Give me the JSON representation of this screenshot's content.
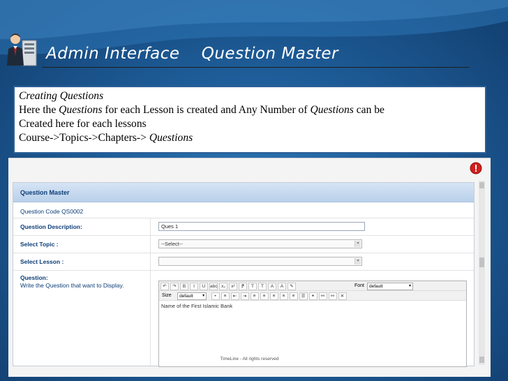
{
  "slide": {
    "title": "Admin Interface    Question Master",
    "description": {
      "line1": "Creating Questions",
      "line2_a": "Here the ",
      "line2_em1": "Questions",
      "line2_b": " for each Lesson is created and Any Number of ",
      "line2_em2": "Questions",
      "line2_c": " can be",
      "line3": "Created here for each lessons",
      "line4_a": "Course->Topics->Chapters-> ",
      "line4_em": "Questions"
    }
  },
  "app": {
    "panel_title": "Question Master",
    "question_code": "Question Code QS0002",
    "fields": {
      "description_label": "Question Description:",
      "description_value": "Ques 1",
      "topic_label": "Select Topic :",
      "topic_value": "--Select--",
      "lesson_label": "Select Lesson :",
      "lesson_value": "",
      "question_label": "Question:",
      "question_hint": "Write the Question that want to Display."
    },
    "editor": {
      "font_label": "Font",
      "font_value": "default",
      "size_label": "Size",
      "size_value": "default",
      "content": "Name of the First Islamic Bank",
      "toolbar_row1": [
        "↶",
        "↷",
        "B",
        "I",
        "U",
        "abc",
        "x₂",
        "x²",
        "⁋",
        "T",
        "T",
        "A",
        "A",
        "✎"
      ],
      "toolbar_row2": [
        "•",
        "≡",
        "⇤",
        "⇥",
        "≡",
        "≡",
        "≡",
        "≡",
        "≡",
        "☰",
        "⚭",
        "⚯",
        "⚯",
        "✕"
      ]
    },
    "footer": "TimeLine - All rights reserved",
    "colors": {
      "slide_bg": "#1e5d99",
      "panel_header": "#c7daf0",
      "label_text": "#0d3e78",
      "alert": "#d21f1f"
    }
  }
}
